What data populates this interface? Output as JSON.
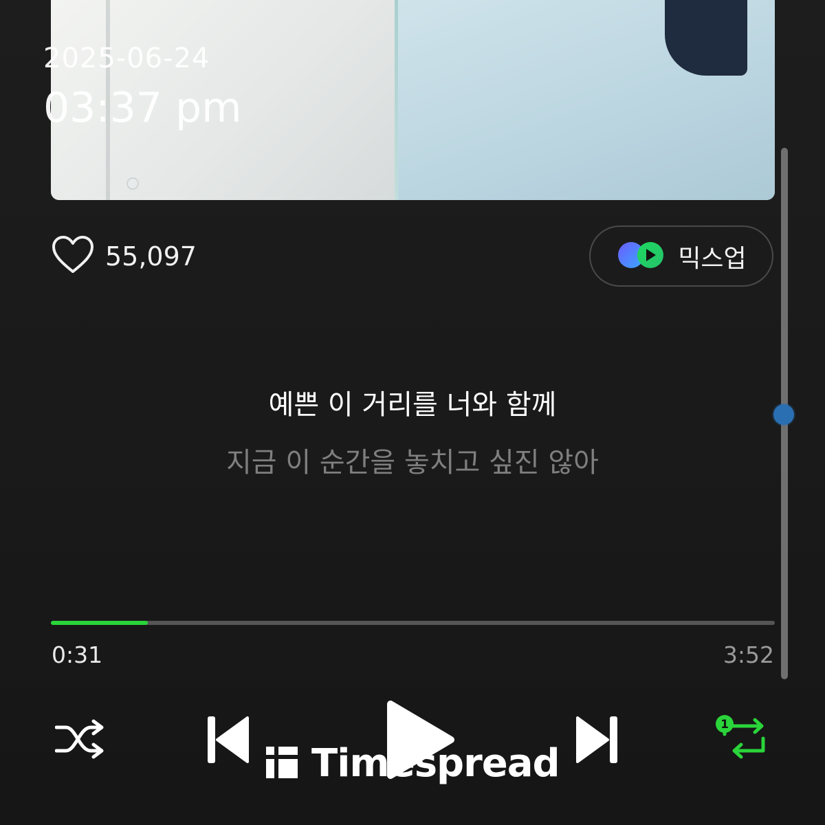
{
  "overlay": {
    "date": "2025-06-24",
    "time": "03:37 pm"
  },
  "album": {
    "icon": "album-art-image"
  },
  "like": {
    "icon": "heart-outline-icon",
    "count": "55,097"
  },
  "mixup": {
    "icon": "mixup-logo-icon",
    "label": "믹스업"
  },
  "lyrics": {
    "current": "예쁜 이 거리를 너와 함께",
    "next": "지금 이 순간을 놓치고 싶진 않아"
  },
  "progress": {
    "elapsed": "0:31",
    "total": "3:52",
    "fraction": 0.1336,
    "fill_color": "#2ad43a"
  },
  "controls": {
    "shuffle_icon": "shuffle-icon",
    "previous_icon": "skip-previous-icon",
    "play_icon": "play-icon",
    "next_icon": "skip-next-icon",
    "repeat_icon": "repeat-one-icon",
    "repeat_badge": "1",
    "repeat_color": "#2ad43a"
  },
  "watermark": {
    "text": "Timespread"
  }
}
